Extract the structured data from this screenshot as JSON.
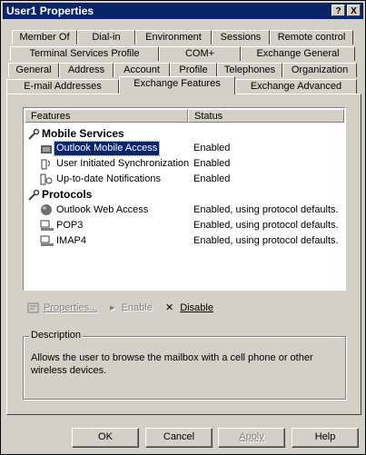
{
  "window": {
    "title": "User1 Properties",
    "help_button": "?",
    "close_button": "X"
  },
  "tabs": {
    "row1": [
      "Member Of",
      "Dial-in",
      "Environment",
      "Sessions",
      "Remote control"
    ],
    "row2": [
      "Terminal Services Profile",
      "COM+",
      "Exchange General"
    ],
    "row3": [
      "General",
      "Address",
      "Account",
      "Profile",
      "Telephones",
      "Organization"
    ],
    "row4": [
      "E-mail Addresses",
      "Exchange Features",
      "Exchange Advanced"
    ],
    "active": "Exchange Features"
  },
  "list": {
    "columns": {
      "features": "Features",
      "status": "Status"
    },
    "groups": [
      {
        "label": "Mobile Services",
        "icon": "wrench-icon",
        "items": [
          {
            "name": "Outlook Mobile Access",
            "status": "Enabled",
            "icon": "mobile-access-icon",
            "selected": true
          },
          {
            "name": "User Initiated Synchronization",
            "status": "Enabled",
            "icon": "sync-icon"
          },
          {
            "name": "Up-to-date Notifications",
            "status": "Enabled",
            "icon": "notification-icon"
          }
        ]
      },
      {
        "label": "Protocols",
        "icon": "wrench-icon",
        "items": [
          {
            "name": "Outlook Web Access",
            "status": "Enabled, using protocol defaults.",
            "icon": "globe-icon"
          },
          {
            "name": "POP3",
            "status": "Enabled, using protocol defaults.",
            "icon": "network-computer-icon"
          },
          {
            "name": "IMAP4",
            "status": "Enabled, using protocol defaults.",
            "icon": "network-computer-icon"
          }
        ]
      }
    ]
  },
  "actions": {
    "properties": "Properties...",
    "enable": "Enable",
    "disable": "Disable"
  },
  "description": {
    "legend": "Description",
    "text": "Allows the user to browse the mailbox with a cell phone or other wireless devices."
  },
  "buttons": {
    "ok": "OK",
    "cancel": "Cancel",
    "apply": "Apply",
    "help": "Help"
  },
  "colors": {
    "title_bar": "#0a246a",
    "face": "#d4d0c8",
    "selection": "#0a246a"
  }
}
